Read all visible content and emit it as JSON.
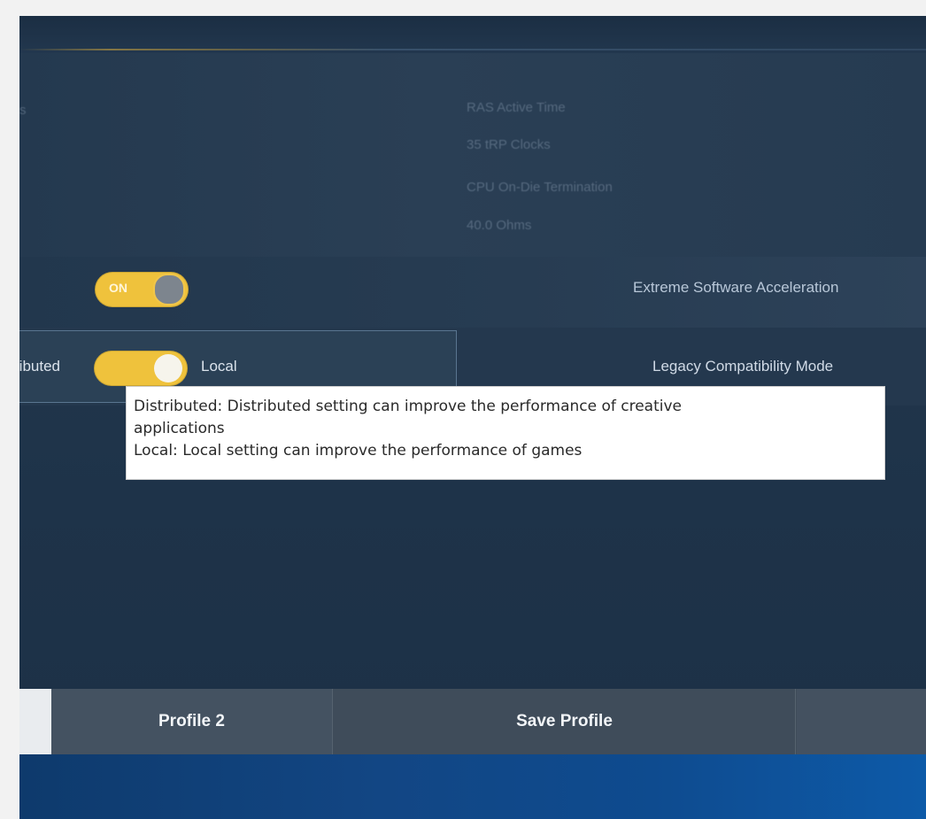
{
  "info": {
    "left_fragment": "s",
    "items": [
      "RAS Active Time",
      "35 tRP Clocks",
      "CPU On-Die Termination",
      "40.0 Ohms"
    ]
  },
  "extreme_acceleration": {
    "label": "Extreme Software Acceleration",
    "toggle_text": "ON",
    "state": "on"
  },
  "legacy_mode": {
    "label": "Legacy Compatibility Mode",
    "option_left": "ributed",
    "option_right": "Local",
    "state": "local"
  },
  "tooltip": {
    "line1": "Distributed: Distributed setting can improve the performance of creative",
    "line2": "applications",
    "line3": "Local: Local setting can improve the performance of games"
  },
  "bottom_bar": {
    "profile1_label": "",
    "profile2_label": "Profile 2",
    "save_label": "Save Profile",
    "extra_label": ""
  },
  "colors": {
    "background": "#22364c",
    "toggle_accent": "#efc23c",
    "bottom_bar": "#3f4c5a",
    "taskbar": "#124684"
  }
}
